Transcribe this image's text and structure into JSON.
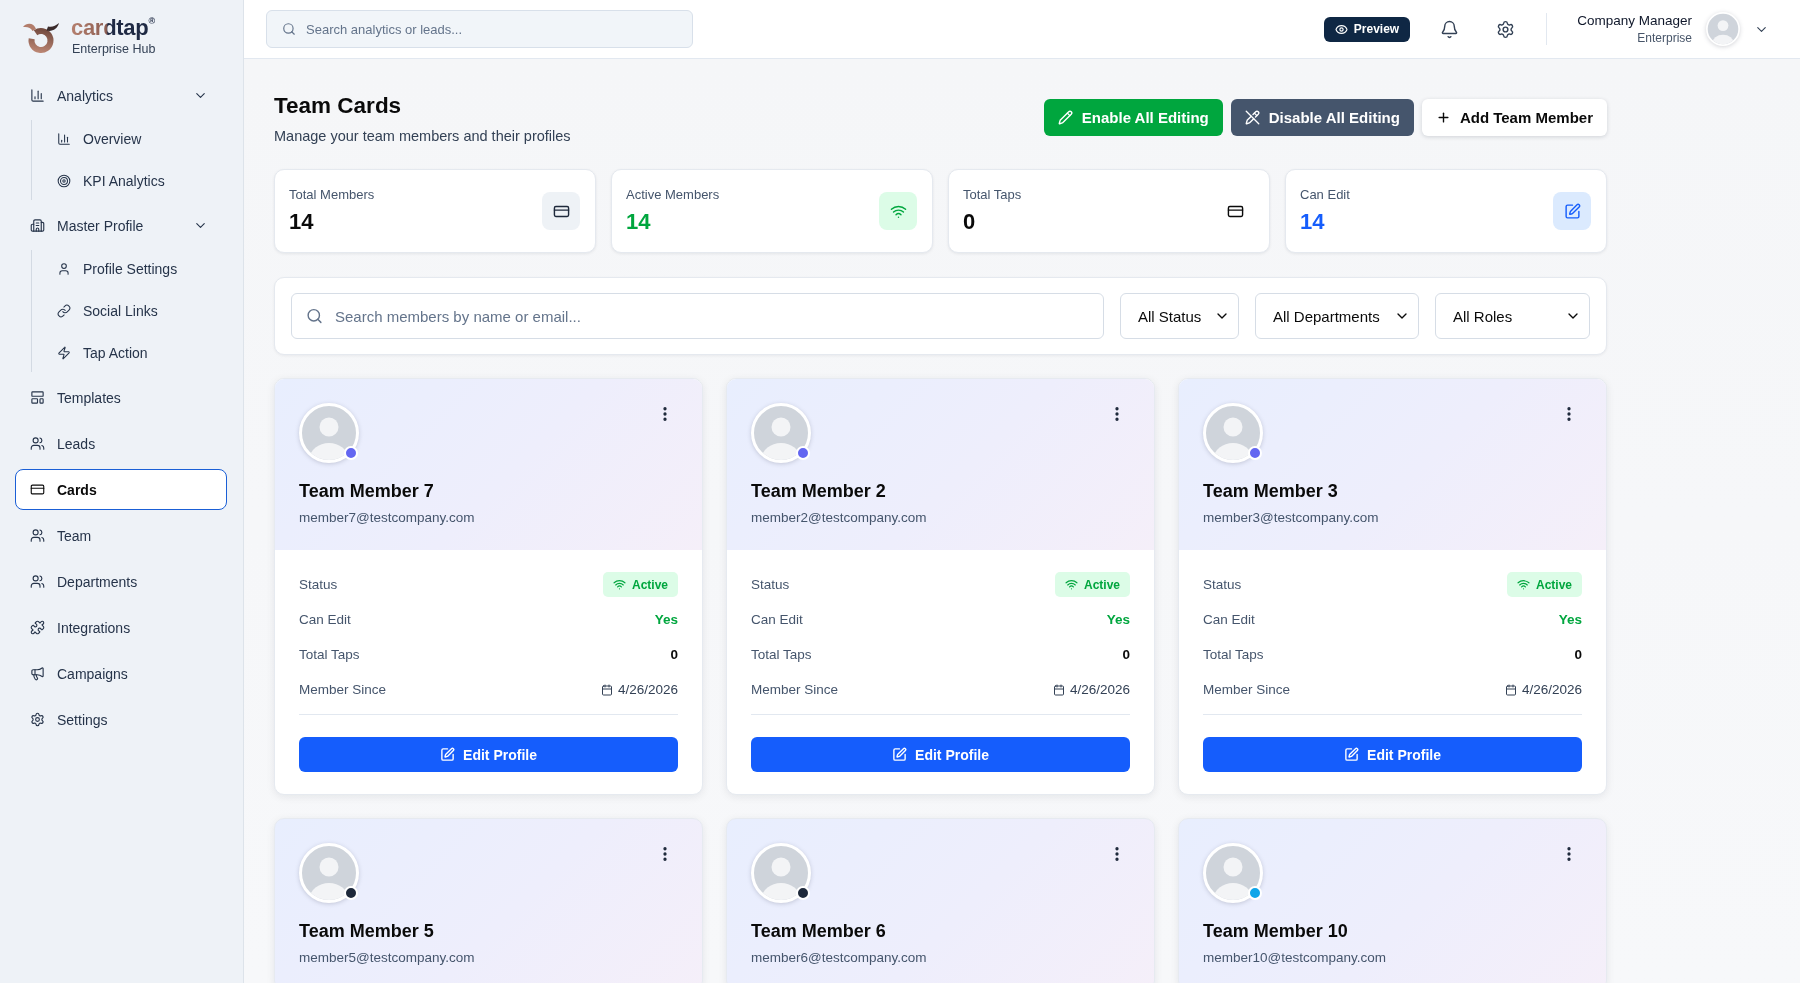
{
  "sidebar": {
    "brand": "cardtap$^{®}$",
    "tagline": "Enterprise Hub",
    "items": [
      {
        "label": "Analytics",
        "selected": false,
        "expanded": true,
        "children": [
          {
            "label": "Overview",
            "selected": false
          },
          {
            "label": "KPI Analytics",
            "selected": false
          }
        ]
      },
      {
        "label": "Master Profile",
        "selected": false,
        "expanded": true,
        "children": [
          {
            "label": "Profile Settings",
            "selected": false
          },
          {
            "label": "Social Links",
            "selected": false
          },
          {
            "label": "Tap Action",
            "selected": false
          }
        ]
      },
      {
        "label": "Templates",
        "selected": false
      },
      {
        "label": "Leads",
        "selected": false
      },
      {
        "label": "Cards",
        "selected": true
      },
      {
        "label": "Team",
        "selected": false
      },
      {
        "label": "Departments",
        "selected": false
      },
      {
        "label": "Integrations",
        "selected": false
      },
      {
        "label": "Campaigns",
        "selected": false
      },
      {
        "label": "Settings",
        "selected": false
      }
    ]
  },
  "topbar": {
    "search": {
      "placeholder": "Search analytics or leads..."
    },
    "preview_button": "Preview",
    "user": {
      "name": "Company Manager",
      "role": "Enterprise"
    }
  },
  "page": {
    "title": "Team Cards",
    "subtitle": "Manage your team members and their profiles",
    "actions": [
      {
        "label": "Enable All Editing",
        "kind": "enable"
      },
      {
        "label": "Disable All Editing",
        "kind": "disable"
      },
      {
        "label": "Add Team Member",
        "kind": "add"
      }
    ]
  },
  "stats": [
    {
      "label": "Total Members",
      "value": "14",
      "kind": "members"
    },
    {
      "label": "Active Members",
      "value": "14",
      "kind": "active"
    },
    {
      "label": "Total Taps",
      "value": "0",
      "kind": "taps"
    },
    {
      "label": "Can Edit",
      "value": "14",
      "kind": "editable"
    }
  ],
  "filters": {
    "search": {
      "placeholder": "Search members by name or email..."
    },
    "selects": [
      {
        "value": "All Status"
      },
      {
        "value": "All Departments"
      },
      {
        "value": "All Roles"
      }
    ]
  },
  "members": [
    {
      "name": "Team Member 7",
      "email": "member7@testcompany.com",
      "color": "#6366f1",
      "details": [
        {
          "label": "Status",
          "value": "Active",
          "kind": "badge"
        },
        {
          "label": "Can Edit",
          "value": "Yes",
          "kind": "positive"
        },
        {
          "label": "Total Taps",
          "value": "0",
          "kind": "number"
        },
        {
          "label": "Member Since",
          "value": "4/26/2026",
          "kind": "date"
        }
      ],
      "action": "Edit Profile"
    },
    {
      "name": "Team Member 2",
      "email": "member2@testcompany.com",
      "color": "#6366f1",
      "details": [
        {
          "label": "Status",
          "value": "Active",
          "kind": "badge"
        },
        {
          "label": "Can Edit",
          "value": "Yes",
          "kind": "positive"
        },
        {
          "label": "Total Taps",
          "value": "0",
          "kind": "number"
        },
        {
          "label": "Member Since",
          "value": "4/26/2026",
          "kind": "date"
        }
      ],
      "action": "Edit Profile"
    },
    {
      "name": "Team Member 3",
      "email": "member3@testcompany.com",
      "color": "#6366f1",
      "details": [
        {
          "label": "Status",
          "value": "Active",
          "kind": "badge"
        },
        {
          "label": "Can Edit",
          "value": "Yes",
          "kind": "positive"
        },
        {
          "label": "Total Taps",
          "value": "0",
          "kind": "number"
        },
        {
          "label": "Member Since",
          "value": "4/26/2026",
          "kind": "date"
        }
      ],
      "action": "Edit Profile"
    },
    {
      "name": "Team Member 5",
      "email": "member5@testcompany.com",
      "color": "#1e293b"
    },
    {
      "name": "Team Member 6",
      "email": "member6@testcompany.com",
      "color": "#1e293b"
    },
    {
      "name": "Team Member 10",
      "email": "member10@testcompany.com",
      "color": "#0ea5e9"
    }
  ]
}
